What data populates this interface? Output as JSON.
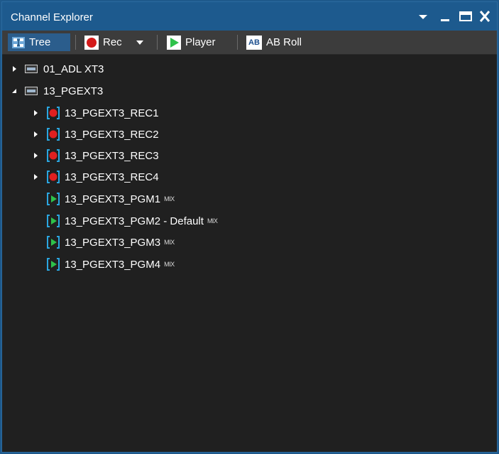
{
  "window": {
    "title": "Channel Explorer"
  },
  "toolbar": {
    "tree_label": "Tree",
    "rec_label": "Rec",
    "player_label": "Player",
    "abroll_label": "AB Roll",
    "abroll_icon_text": "AB"
  },
  "tree": {
    "nodes": [
      {
        "label": "01_ADL XT3",
        "state": "collapsed"
      },
      {
        "label": "13_PGEXT3",
        "state": "expanded"
      }
    ],
    "children": [
      {
        "label": "13_PGEXT3_REC1",
        "type": "rec",
        "icon": "record-icon"
      },
      {
        "label": "13_PGEXT3_REC2",
        "type": "rec",
        "icon": "record-icon"
      },
      {
        "label": "13_PGEXT3_REC3",
        "type": "rec",
        "icon": "record-icon"
      },
      {
        "label": "13_PGEXT3_REC4",
        "type": "rec",
        "icon": "record-icon"
      },
      {
        "label": "13_PGEXT3_PGM1",
        "type": "pgm",
        "icon": "player-icon",
        "badge": "MIX"
      },
      {
        "label": "13_PGEXT3_PGM2 - Default",
        "type": "pgm",
        "icon": "player-icon",
        "badge": "MIX"
      },
      {
        "label": "13_PGEXT3_PGM3",
        "type": "pgm",
        "icon": "player-icon",
        "badge": "MIX"
      },
      {
        "label": "13_PGEXT3_PGM4",
        "type": "pgm",
        "icon": "player-icon",
        "badge": "MIX"
      }
    ]
  },
  "colors": {
    "titlebar": "#1d5a8e",
    "toolbar": "#3c3c3c",
    "panel": "#202020",
    "record_red": "#e02020",
    "player_green": "#2ec24a",
    "bracket_blue": "#2aa6e0"
  }
}
